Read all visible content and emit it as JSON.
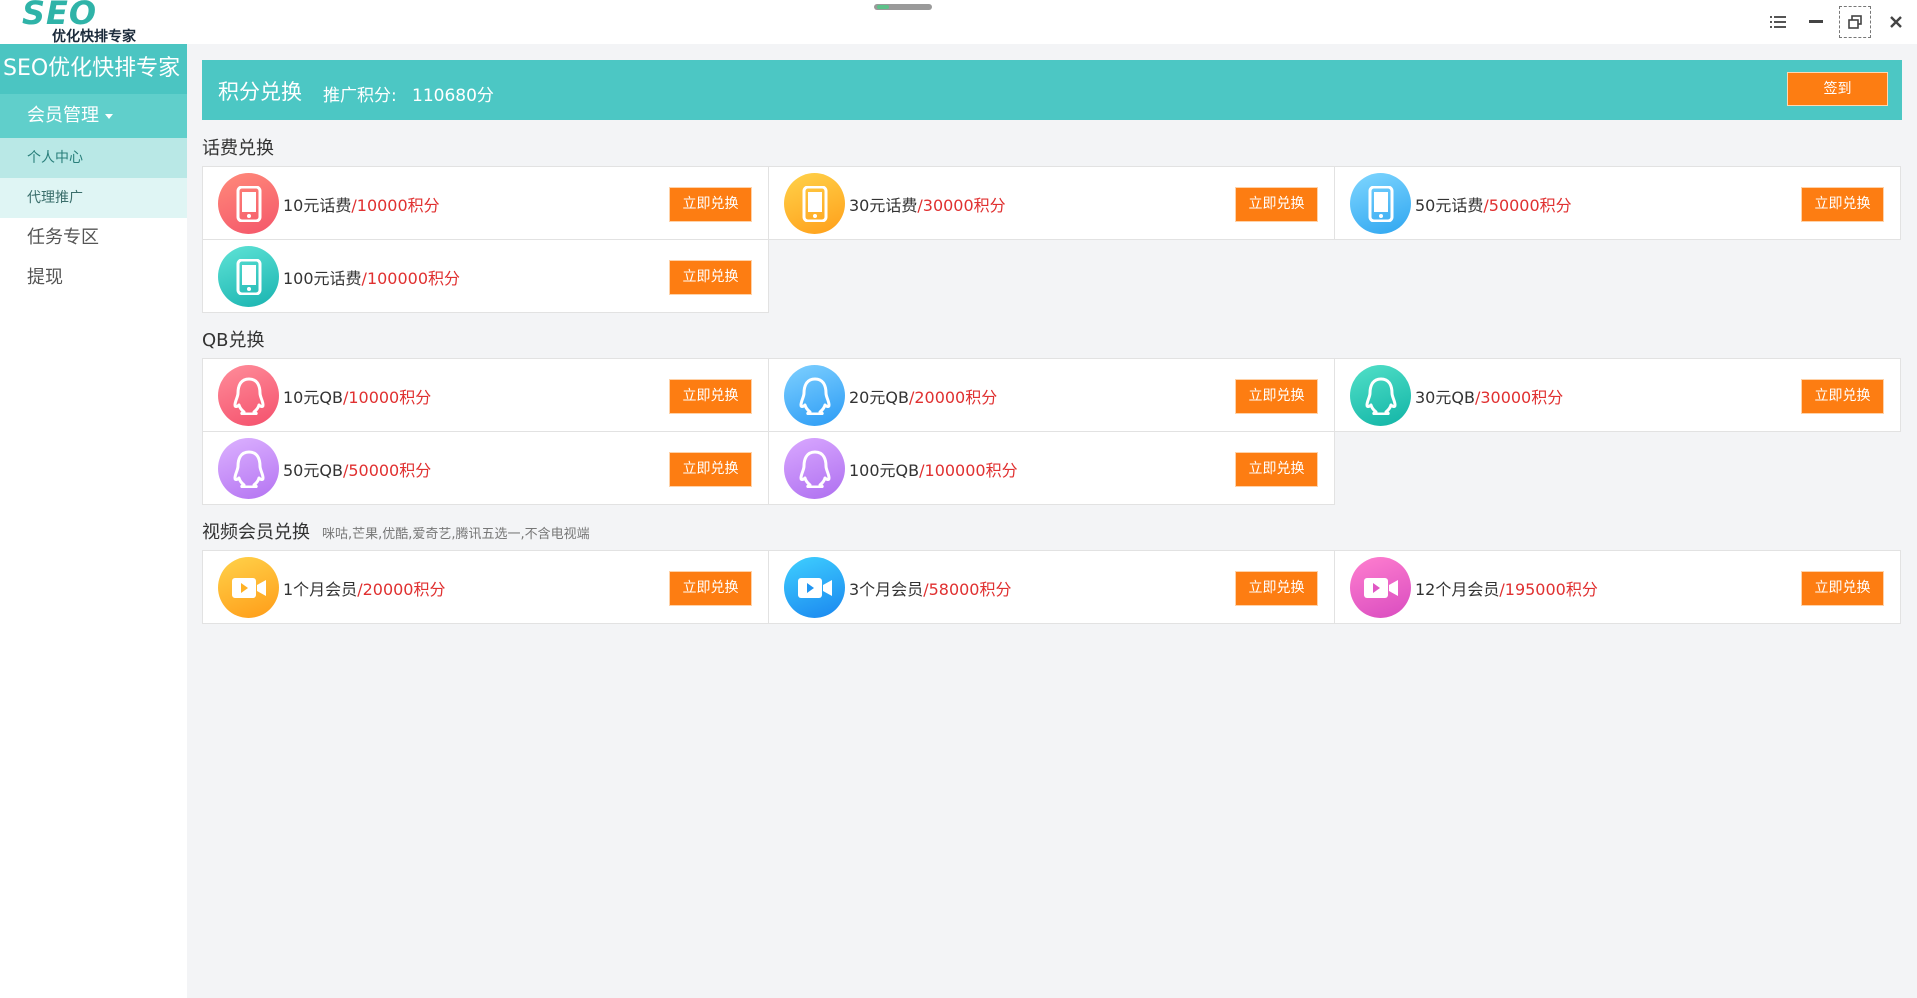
{
  "app": {
    "logo_text": "SEO",
    "logo_subtitle": "优化快排专家"
  },
  "sidebar": {
    "brand": "SEO优化快排专家",
    "group_label": "会员管理",
    "sub_items": [
      {
        "label": "个人中心",
        "active": true
      },
      {
        "label": "代理推广",
        "active": false
      }
    ],
    "items": [
      {
        "label": "任务专区"
      },
      {
        "label": "提现"
      }
    ]
  },
  "header": {
    "title": "积分兑换",
    "points_label": "推广积分:",
    "points_value": "110680分",
    "signin_label": "签到"
  },
  "sections": [
    {
      "title": "话费兑换",
      "note": "",
      "cards": [
        {
          "name": "10元话费",
          "points": "/10000积分",
          "icon": "phone-icon",
          "color": "red",
          "button": "立即兑换"
        },
        {
          "name": "30元话费",
          "points": "/30000积分",
          "icon": "phone-icon",
          "color": "orange",
          "button": "立即兑换"
        },
        {
          "name": "50元话费",
          "points": "/50000积分",
          "icon": "phone-icon",
          "color": "blue",
          "button": "立即兑换"
        },
        {
          "name": "100元话费",
          "points": "/100000积分",
          "icon": "phone-icon",
          "color": "teal",
          "button": "立即兑换"
        }
      ]
    },
    {
      "title": "QB兑换",
      "note": "",
      "cards": [
        {
          "name": "10元QB",
          "points": "/10000积分",
          "icon": "qq-penguin-icon",
          "color": "pink",
          "button": "立即兑换"
        },
        {
          "name": "20元QB",
          "points": "/20000积分",
          "icon": "qq-penguin-icon",
          "color": "sky",
          "button": "立即兑换"
        },
        {
          "name": "30元QB",
          "points": "/30000积分",
          "icon": "qq-penguin-icon",
          "color": "green",
          "button": "立即兑换"
        },
        {
          "name": "50元QB",
          "points": "/50000积分",
          "icon": "qq-penguin-icon",
          "color": "violet",
          "button": "立即兑换"
        },
        {
          "name": "100元QB",
          "points": "/100000积分",
          "icon": "qq-penguin-icon",
          "color": "violet2",
          "button": "立即兑换"
        }
      ]
    },
    {
      "title": "视频会员兑换",
      "note": "咪咕,芒果,优酷,爱奇艺,腾讯五选一,不含电视端",
      "cards": [
        {
          "name": "1个月会员",
          "points": "/20000积分",
          "icon": "video-camera-icon",
          "color": "yellow",
          "button": "立即兑换"
        },
        {
          "name": "3个月会员",
          "points": "/58000积分",
          "icon": "video-camera-icon",
          "color": "azure",
          "button": "立即兑换"
        },
        {
          "name": "12个月会员",
          "points": "/195000积分",
          "icon": "video-camera-icon",
          "color": "magenta",
          "button": "立即兑换"
        }
      ]
    }
  ],
  "colors": {
    "accent": "#4cc7c4",
    "button": "#fd7d12",
    "points_text": "#e03030"
  }
}
